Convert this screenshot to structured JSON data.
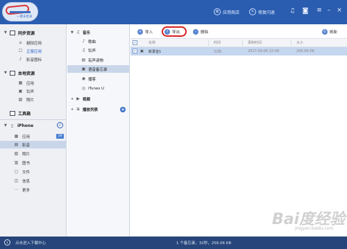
{
  "app": {
    "logo_subtitle": "一键未登录",
    "top_buttons": [
      "应用商店",
      "修复闪退"
    ],
    "icons": [
      "music-icon",
      "shirt-icon",
      "menu-icon",
      "minimize-icon",
      "close-icon"
    ]
  },
  "sidebar": {
    "sections": [
      {
        "label": "同步资源",
        "items": [
          "越狱应用",
          "正版应用",
          "影音图标"
        ]
      },
      {
        "label": "本地资源",
        "items": [
          "应用",
          "铃声",
          "照片"
        ]
      },
      {
        "label": "工具箱",
        "items": []
      }
    ],
    "device": {
      "name": "iPhone",
      "items": [
        {
          "label": "应用",
          "badge": "29"
        },
        {
          "label": "影音"
        },
        {
          "label": "照片"
        },
        {
          "label": "图书"
        },
        {
          "label": "文件"
        },
        {
          "label": "信息"
        },
        {
          "label": "更多"
        }
      ]
    }
  },
  "tree": {
    "music": "音乐",
    "music_items": [
      "歌曲",
      "铃声",
      "有声读物",
      "语音备忘录",
      "播客",
      "iTunes U"
    ],
    "video": "视频",
    "playlists": "播放列表"
  },
  "toolbar": {
    "import": "导入",
    "export": "导出",
    "delete": "删除",
    "refresh": "刷新"
  },
  "table": {
    "headers": [
      "名称",
      "时间",
      "录制时间",
      "大小"
    ],
    "rows": [
      {
        "name": "新录音1",
        "time": "32秒",
        "recorded": "2017-09-06 22:09",
        "size": "256.06 KB"
      }
    ]
  },
  "footer": {
    "left": "点击进入下载中心",
    "status": "1 个备忘录，32秒，256.06 KB"
  },
  "watermark": {
    "text": "Bai度经验",
    "url": "jingyan.baidu.com"
  },
  "colors": {
    "titlebar": "#2a5db0",
    "selected": "#c9d6ea",
    "row_selected": "#c5d6ef",
    "export_ring": "#d81e1e",
    "footer": "#27457a"
  }
}
